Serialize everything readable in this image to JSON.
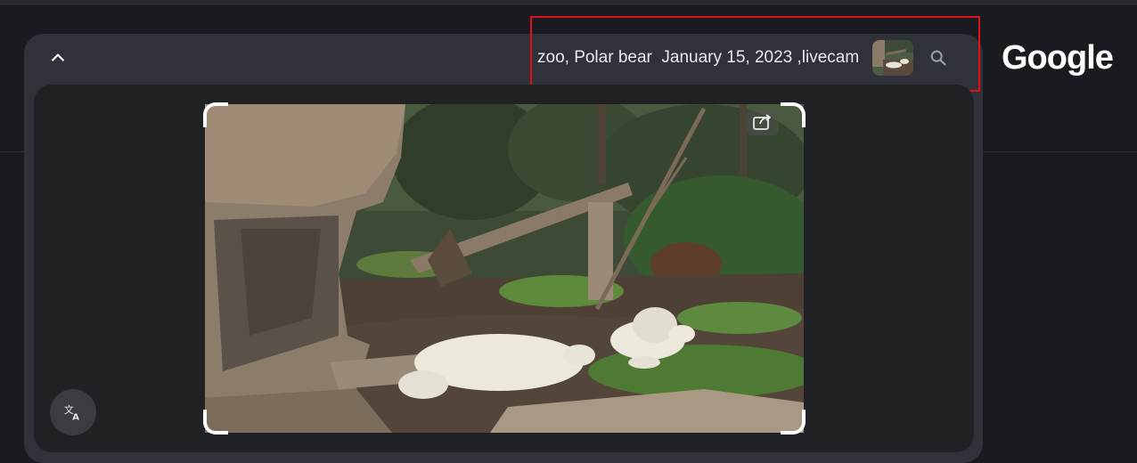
{
  "search": {
    "query": "zoo, Polar bear  January 15, 2023 ,livecam"
  },
  "header": {
    "logo_text": "Google"
  },
  "icons": {
    "collapse": "chevron-up-icon",
    "search": "search-icon",
    "share": "share-icon",
    "translate": "translate-icon"
  },
  "colors": {
    "highlight_border": "#e0101c",
    "panel_bg": "#303239",
    "card_bg": "#202124",
    "page_bg": "#1a1b20"
  }
}
